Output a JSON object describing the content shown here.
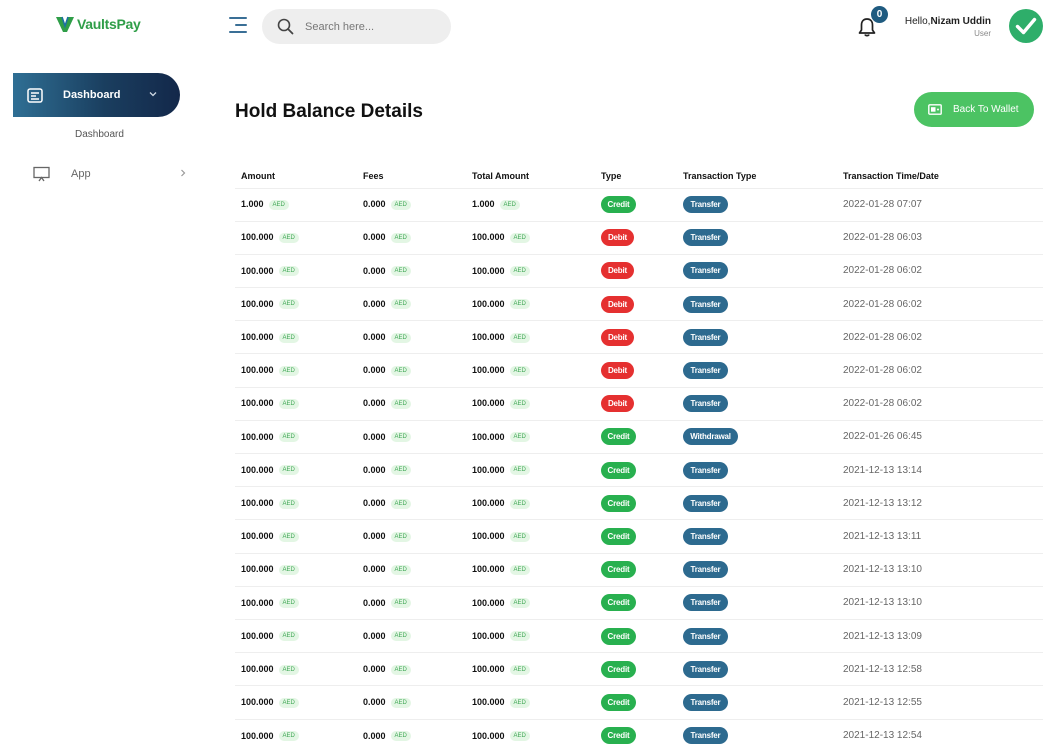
{
  "brand": {
    "name": "VaultsPay",
    "accent": "#2f9e48"
  },
  "header": {
    "search_placeholder": "Search here...",
    "notification_count": "0",
    "hello": "Hello,",
    "user_name": "Nizam Uddin",
    "user_role": "User"
  },
  "sidebar": {
    "items": [
      {
        "label": "Dashboard",
        "icon": "dashboard-icon",
        "active": true
      },
      {
        "label": "App",
        "icon": "monitor-icon",
        "active": false
      }
    ],
    "sub_label": "Dashboard"
  },
  "page": {
    "title": "Hold Balance Details",
    "back_button": "Back To Wallet"
  },
  "table": {
    "columns": [
      "Amount",
      "Fees",
      "Total Amount",
      "Type",
      "Transaction Type",
      "Transaction Time/Date"
    ],
    "currency": "AED",
    "rows": [
      {
        "amount": "1.000",
        "fees": "0.000",
        "total": "1.000",
        "type": "Credit",
        "ttype": "Transfer",
        "date": "2022-01-28 07:07"
      },
      {
        "amount": "100.000",
        "fees": "0.000",
        "total": "100.000",
        "type": "Debit",
        "ttype": "Transfer",
        "date": "2022-01-28 06:03"
      },
      {
        "amount": "100.000",
        "fees": "0.000",
        "total": "100.000",
        "type": "Debit",
        "ttype": "Transfer",
        "date": "2022-01-28 06:02"
      },
      {
        "amount": "100.000",
        "fees": "0.000",
        "total": "100.000",
        "type": "Debit",
        "ttype": "Transfer",
        "date": "2022-01-28 06:02"
      },
      {
        "amount": "100.000",
        "fees": "0.000",
        "total": "100.000",
        "type": "Debit",
        "ttype": "Transfer",
        "date": "2022-01-28 06:02"
      },
      {
        "amount": "100.000",
        "fees": "0.000",
        "total": "100.000",
        "type": "Debit",
        "ttype": "Transfer",
        "date": "2022-01-28 06:02"
      },
      {
        "amount": "100.000",
        "fees": "0.000",
        "total": "100.000",
        "type": "Debit",
        "ttype": "Transfer",
        "date": "2022-01-28 06:02"
      },
      {
        "amount": "100.000",
        "fees": "0.000",
        "total": "100.000",
        "type": "Credit",
        "ttype": "Withdrawal",
        "date": "2022-01-26 06:45"
      },
      {
        "amount": "100.000",
        "fees": "0.000",
        "total": "100.000",
        "type": "Credit",
        "ttype": "Transfer",
        "date": "2021-12-13 13:14"
      },
      {
        "amount": "100.000",
        "fees": "0.000",
        "total": "100.000",
        "type": "Credit",
        "ttype": "Transfer",
        "date": "2021-12-13 13:12"
      },
      {
        "amount": "100.000",
        "fees": "0.000",
        "total": "100.000",
        "type": "Credit",
        "ttype": "Transfer",
        "date": "2021-12-13 13:11"
      },
      {
        "amount": "100.000",
        "fees": "0.000",
        "total": "100.000",
        "type": "Credit",
        "ttype": "Transfer",
        "date": "2021-12-13 13:10"
      },
      {
        "amount": "100.000",
        "fees": "0.000",
        "total": "100.000",
        "type": "Credit",
        "ttype": "Transfer",
        "date": "2021-12-13 13:10"
      },
      {
        "amount": "100.000",
        "fees": "0.000",
        "total": "100.000",
        "type": "Credit",
        "ttype": "Transfer",
        "date": "2021-12-13 13:09"
      },
      {
        "amount": "100.000",
        "fees": "0.000",
        "total": "100.000",
        "type": "Credit",
        "ttype": "Transfer",
        "date": "2021-12-13 12:58"
      },
      {
        "amount": "100.000",
        "fees": "0.000",
        "total": "100.000",
        "type": "Credit",
        "ttype": "Transfer",
        "date": "2021-12-13 12:55"
      },
      {
        "amount": "100.000",
        "fees": "0.000",
        "total": "100.000",
        "type": "Credit",
        "ttype": "Transfer",
        "date": "2021-12-13 12:54"
      }
    ]
  },
  "colors": {
    "credit": "#28b04f",
    "debit": "#e53030",
    "transaction_type": "#2d6a8f",
    "primary_button": "#4cc363",
    "sidebar_active": "#1a3e5f"
  }
}
